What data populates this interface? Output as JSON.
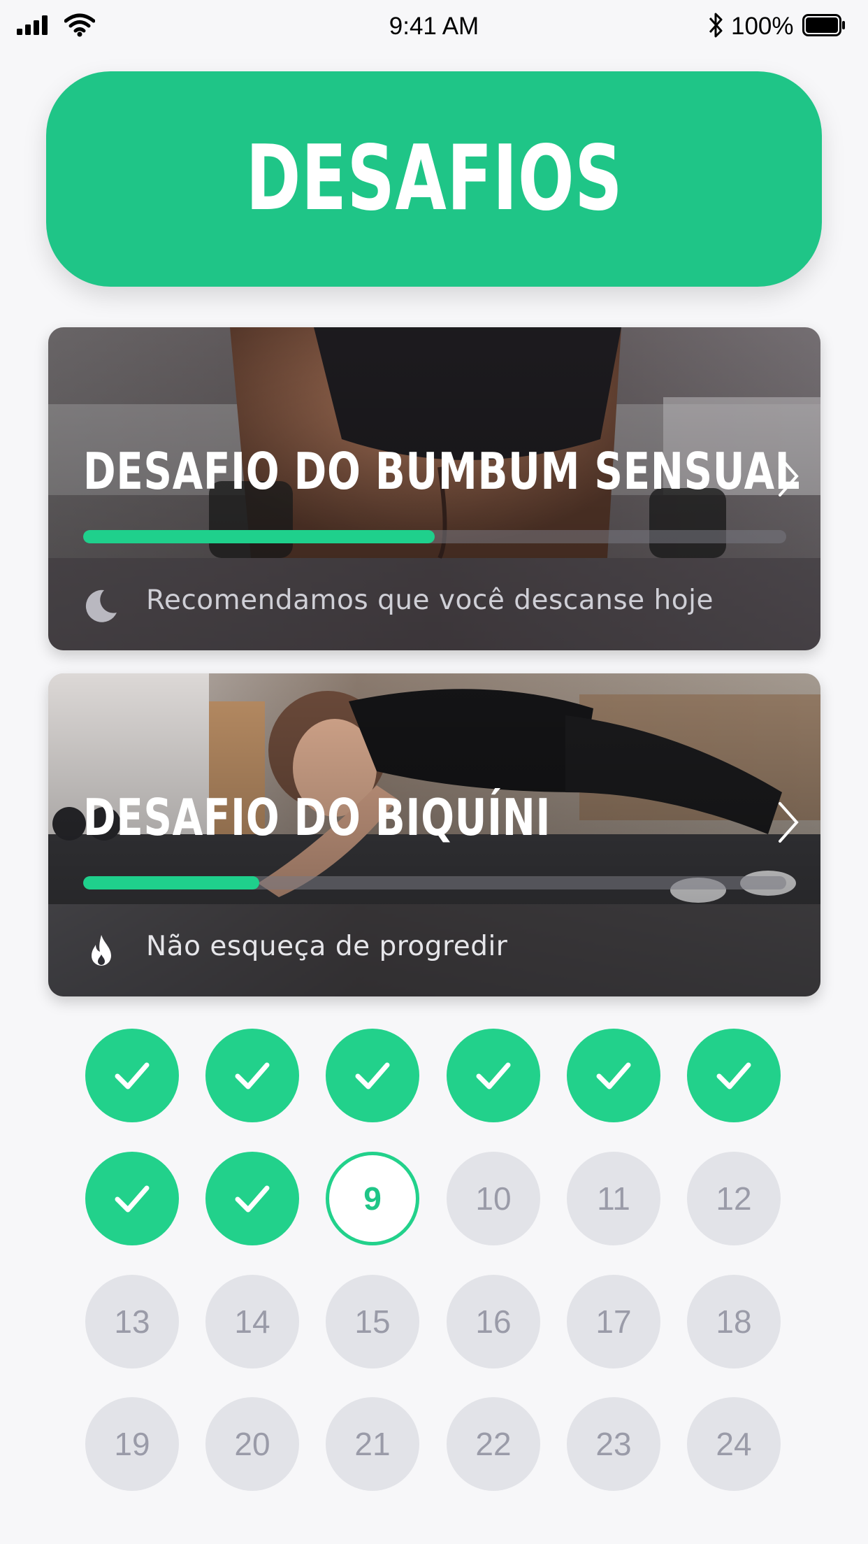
{
  "status_bar": {
    "time": "9:41 AM",
    "battery_percent": "100%",
    "icons": [
      "cellular-signal-icon",
      "wifi-icon",
      "bluetooth-icon",
      "battery-icon"
    ]
  },
  "header": {
    "title": "DESAFIOS",
    "color": "#1fc587"
  },
  "challenges": [
    {
      "title": "DESAFIO DO BUMBUM SENSUAL",
      "progress": 0.5,
      "footer_icon": "moon-icon",
      "footer_text": "Recomendamos que você descanse hoje"
    },
    {
      "title": "DESAFIO DO BIQUÍNI",
      "progress": 0.25,
      "footer_icon": "flame-icon",
      "footer_text": "Não esqueça de progredir"
    }
  ],
  "days": {
    "completed": [
      1,
      2,
      3,
      4,
      5,
      6,
      7,
      8
    ],
    "current": "9",
    "upcoming": [
      "10",
      "11",
      "12",
      "13",
      "14",
      "15",
      "16",
      "17",
      "18",
      "19",
      "20",
      "21",
      "22",
      "23",
      "24"
    ]
  },
  "colors": {
    "accent": "#22d18b",
    "future_day_bg": "#e2e3e8",
    "future_day_text": "#9a9ba8",
    "background": "#f7f7f9"
  }
}
